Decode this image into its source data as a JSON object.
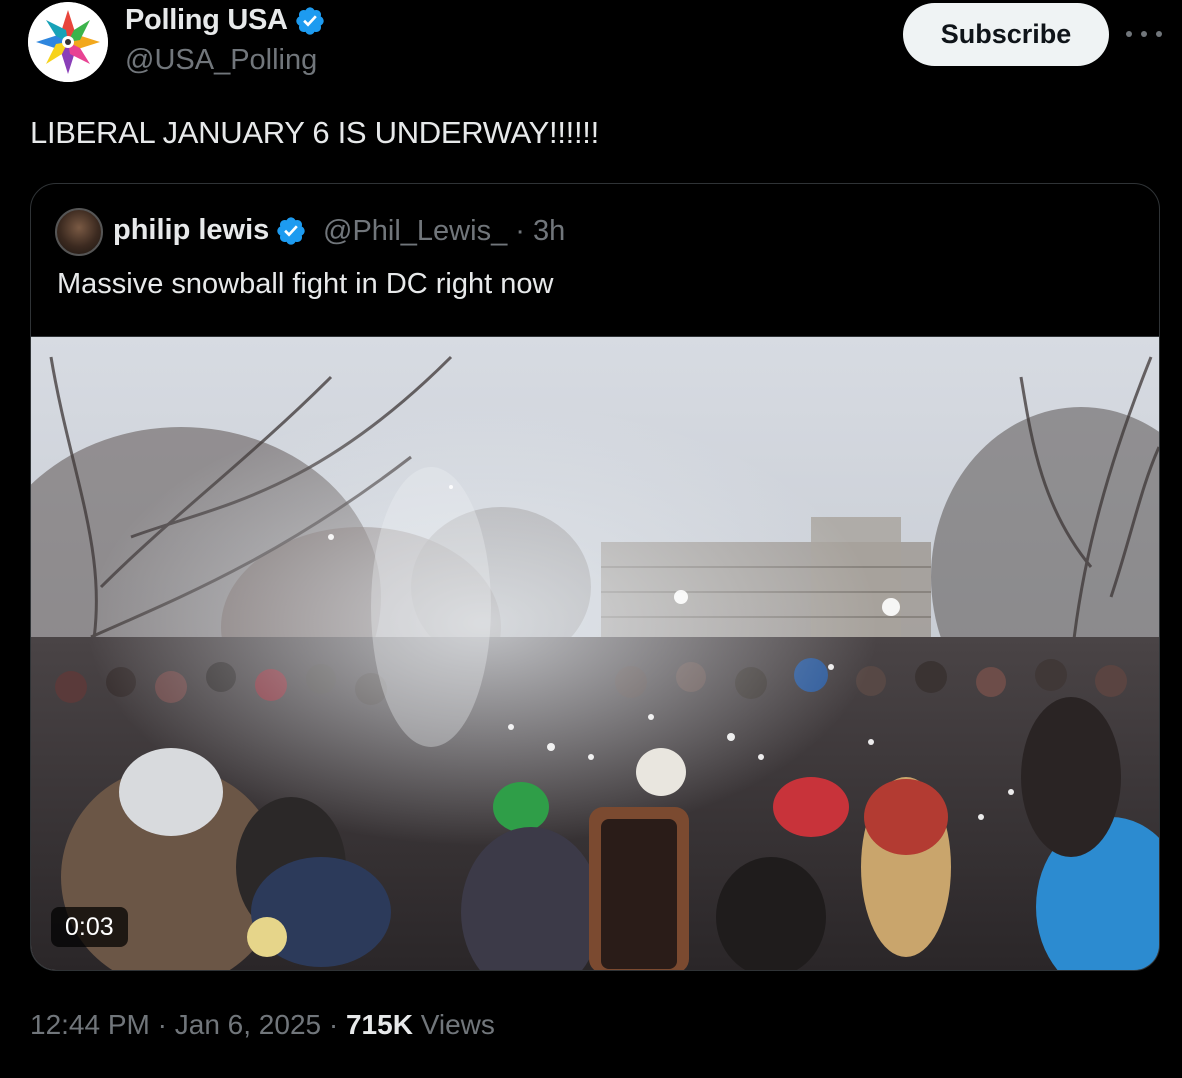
{
  "author": {
    "name": "Polling USA",
    "handle": "@USA_Polling",
    "avatar_icon": "star-of-polls-logo",
    "verified_color": "#1d9bf0"
  },
  "actions": {
    "subscribe_label": "Subscribe",
    "more_icon": "more-dots-icon"
  },
  "tweet": {
    "text": "LIBERAL JANUARY 6 IS UNDERWAY!!!!!!"
  },
  "quoted": {
    "name": "philip lewis",
    "handle": "@Phil_Lewis_",
    "separator": "·",
    "time": "3h",
    "text": "Massive snowball fight in DC right now",
    "video_duration": "0:03"
  },
  "footer": {
    "time": "12:44 PM",
    "date": "Jan 6, 2025",
    "separator": "·",
    "views_count": "715K",
    "views_label": "Views"
  }
}
